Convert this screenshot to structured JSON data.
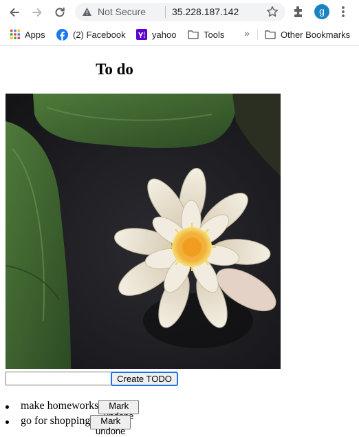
{
  "browser": {
    "security_label": "Not Secure",
    "url": "35.228.187.142",
    "profile_initial": "g",
    "bookmarks": [
      {
        "label": "Apps",
        "icon": "apps-grid-icon"
      },
      {
        "label": "(2) Facebook",
        "icon": "facebook-icon"
      },
      {
        "label": "yahoo",
        "icon": "yahoo-icon"
      },
      {
        "label": "Tools",
        "icon": "folder-icon"
      }
    ],
    "overflow_label": "»",
    "other_bookmarks_label": "Other Bookmarks",
    "colors": {
      "avatar": "#1a83c3",
      "facebook": "#1877f2",
      "yahoo": "#5f01d1"
    }
  },
  "page": {
    "title": "To do",
    "input_value": "",
    "create_button_label": "Create TODO",
    "todos": [
      {
        "text": "make homeworks",
        "button_label": "Mark undone"
      },
      {
        "text": "go for shopping",
        "button_label": "Mark undone"
      }
    ]
  }
}
